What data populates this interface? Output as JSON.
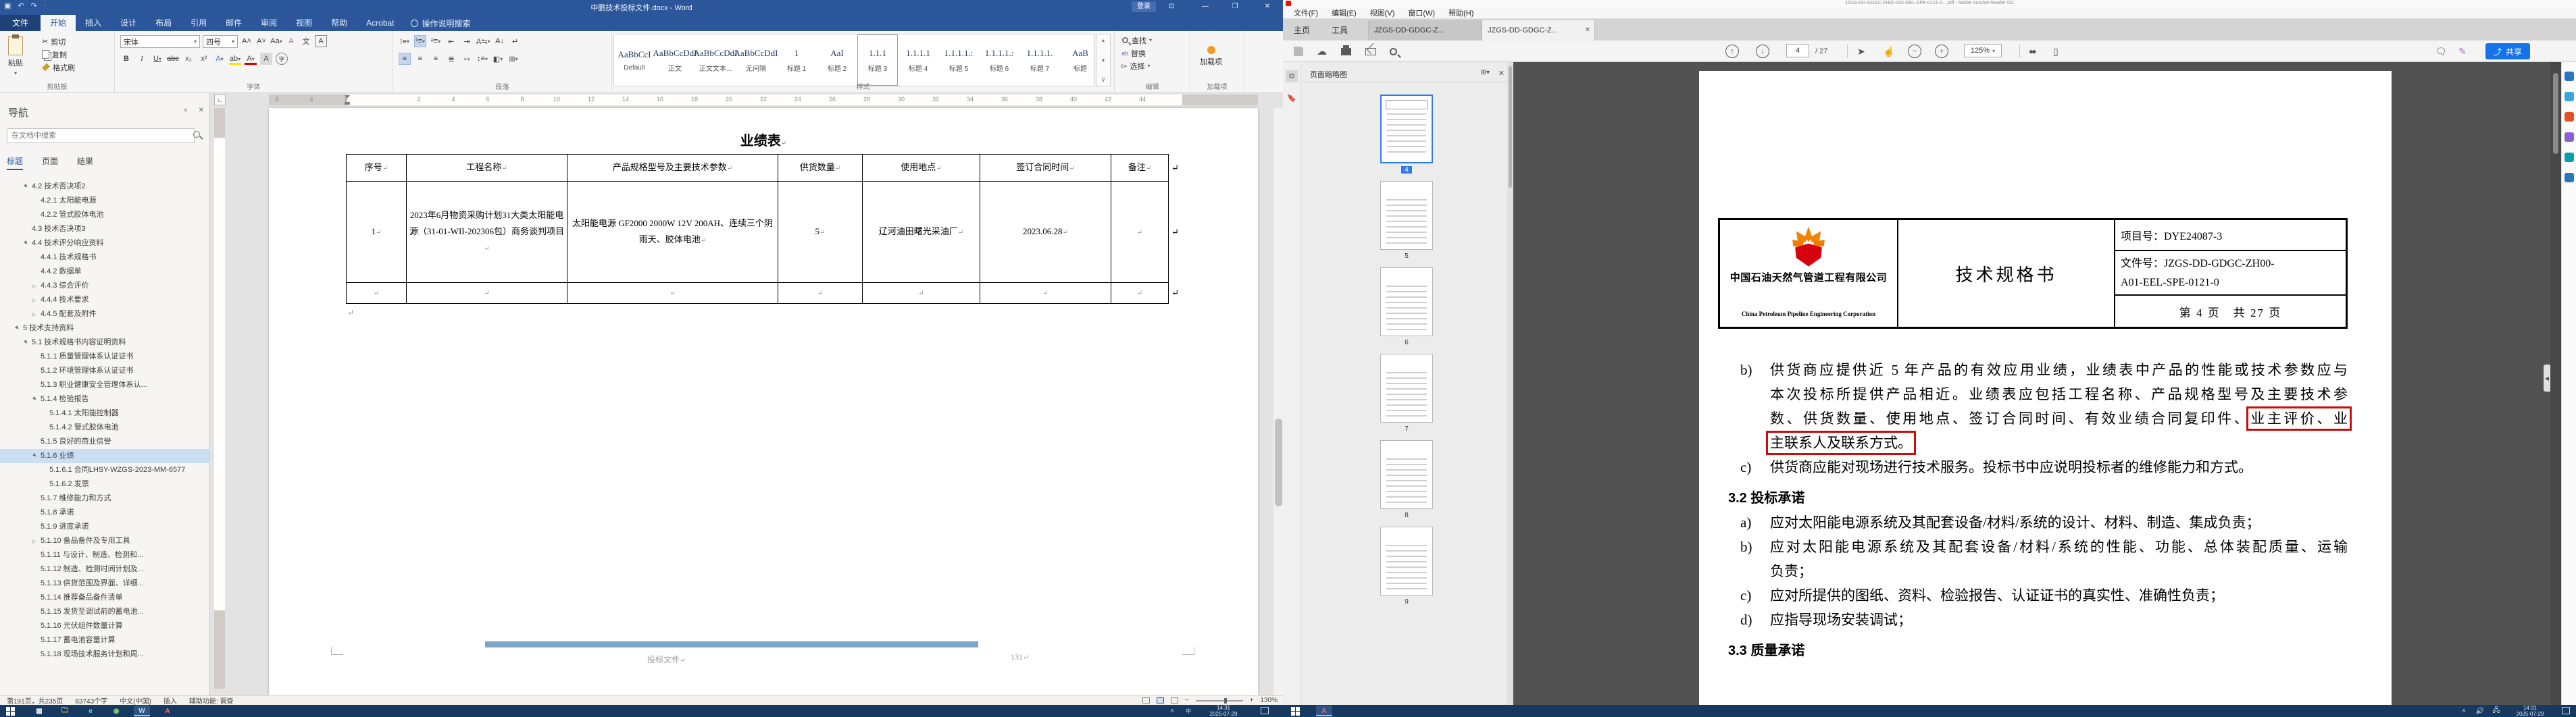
{
  "word": {
    "title": "中鹏技术投标文件.docx - Word",
    "login": "登录",
    "share": "共享",
    "tabs": [
      {
        "label": "文件",
        "file": true
      },
      {
        "label": "开始",
        "active": true
      },
      {
        "label": "插入"
      },
      {
        "label": "设计"
      },
      {
        "label": "布局"
      },
      {
        "label": "引用"
      },
      {
        "label": "邮件"
      },
      {
        "label": "审阅"
      },
      {
        "label": "视图"
      },
      {
        "label": "帮助"
      },
      {
        "label": "Acrobat"
      }
    ],
    "tell_me": "操作说明搜索",
    "ribbon": {
      "paste": "粘贴",
      "cut": "剪切",
      "copy": "复制",
      "format_painter": "格式刷",
      "clipboard_group": "剪贴板",
      "font_name": "宋体",
      "font_size": "四号",
      "font_group": "字体",
      "para_group": "段落",
      "styles_group": "样式",
      "find": "查找",
      "replace": "替换",
      "select": "选择",
      "edit_group": "编辑",
      "addins": "加载项",
      "addins_group": "加载项"
    },
    "styles": [
      {
        "preview": "AaBbCcI",
        "label": "Default"
      },
      {
        "preview": "AaBbCcDdI",
        "label": "正文"
      },
      {
        "preview": "AaBbCcDdI",
        "label": "正文文本..."
      },
      {
        "preview": "AaBbCcDdI",
        "label": "无间隔"
      },
      {
        "preview": "1",
        "label": "标题 1"
      },
      {
        "preview": "AaI",
        "label": "标题 2"
      },
      {
        "preview": "1.1.1",
        "label": "标题 3",
        "selected": true
      },
      {
        "preview": "1.1.1.1",
        "label": "标题 4"
      },
      {
        "preview": "1.1.1.1.:",
        "label": "标题 5"
      },
      {
        "preview": "1.1.1.1.:",
        "label": "标题 6"
      },
      {
        "preview": "1.1.1.1.",
        "label": "标题 7"
      },
      {
        "preview": "AaB",
        "label": "标题"
      }
    ],
    "nav": {
      "title": "导航",
      "search_placeholder": "在文档中搜索",
      "tabs": [
        {
          "label": "标题",
          "active": true
        },
        {
          "label": "页面"
        },
        {
          "label": "结果"
        }
      ],
      "tree": [
        {
          "label": "4.2 技术否决项2",
          "lv": 1,
          "exp": "open"
        },
        {
          "label": "4.2.1 太阳能电源",
          "lv": 2,
          "exp": "leaf"
        },
        {
          "label": "4.2.2 管式胶体电池",
          "lv": 2,
          "exp": "leaf"
        },
        {
          "label": "4.3 技术否决项3",
          "lv": 1,
          "exp": "leaf"
        },
        {
          "label": "4.4 技术评分响应资料",
          "lv": 1,
          "exp": "open"
        },
        {
          "label": "4.4.1 技术规格书",
          "lv": 2,
          "exp": "leaf"
        },
        {
          "label": "4.4.2 数据单",
          "lv": 2,
          "exp": "leaf"
        },
        {
          "label": "4.4.3 综合评价",
          "lv": 2,
          "exp": "closed"
        },
        {
          "label": "4.4.4 技术要求",
          "lv": 2,
          "exp": "closed"
        },
        {
          "label": "4.4.5 配套及附件",
          "lv": 2,
          "exp": "closed"
        },
        {
          "label": "5 技术支持资料",
          "lv": 0,
          "exp": "open"
        },
        {
          "label": "5.1 技术规格书内容证明资料",
          "lv": 1,
          "exp": "open"
        },
        {
          "label": "5.1.1 质量管理体系认证证书",
          "lv": 2,
          "exp": "leaf"
        },
        {
          "label": "5.1.2 环境管理体系认证证书",
          "lv": 2,
          "exp": "leaf"
        },
        {
          "label": "5.1.3 职业健康安全管理体系认...",
          "lv": 2,
          "exp": "leaf"
        },
        {
          "label": "5.1.4 检验报告",
          "lv": 2,
          "exp": "open"
        },
        {
          "label": "5.1.4.1 太阳能控制器",
          "lv": 3,
          "exp": "leaf"
        },
        {
          "label": "5.1.4.2 管式胶体电池",
          "lv": 3,
          "exp": "leaf"
        },
        {
          "label": "5.1.5 良好的商业信誉",
          "lv": 2,
          "exp": "leaf"
        },
        {
          "label": "5.1.6 业绩",
          "lv": 2,
          "exp": "open",
          "selected": true
        },
        {
          "label": "5.1.6.1 合同LHSY-WZGS-2023-MM-6577",
          "lv": 3,
          "exp": "leaf"
        },
        {
          "label": "5.1.6.2 发票",
          "lv": 3,
          "exp": "leaf"
        },
        {
          "label": "5.1.7 维修能力和方式",
          "lv": 2,
          "exp": "leaf"
        },
        {
          "label": "5.1.8 承诺",
          "lv": 2,
          "exp": "leaf"
        },
        {
          "label": "5.1.9 进度承诺",
          "lv": 2,
          "exp": "leaf"
        },
        {
          "label": "5.1.10 备品备件及专用工具",
          "lv": 2,
          "exp": "closed"
        },
        {
          "label": "5.1.11 与设计、制造、检测和...",
          "lv": 2,
          "exp": "leaf"
        },
        {
          "label": "5.1.12 制造、检测时间计划及...",
          "lv": 2,
          "exp": "leaf"
        },
        {
          "label": "5.1.13 供货范围及界面、详细...",
          "lv": 2,
          "exp": "leaf"
        },
        {
          "label": "5.1.14 推荐备品备件清单",
          "lv": 2,
          "exp": "leaf"
        },
        {
          "label": "5.1.15 发货至调试前的蓄电池...",
          "lv": 2,
          "exp": "leaf"
        },
        {
          "label": "5.1.16 光伏组件数量计算",
          "lv": 2,
          "exp": "leaf"
        },
        {
          "label": "5.1.17 蓄电池容量计算",
          "lv": 2,
          "exp": "leaf"
        },
        {
          "label": "5.1.18 现场技术服务计划和周...",
          "lv": 2,
          "exp": "leaf"
        }
      ]
    },
    "doc": {
      "table_title": "业绩表",
      "mark": "↵",
      "headers": [
        "序号",
        "工程名称",
        "产品规格型号及主要技术参数",
        "供货数量",
        "使用地点",
        "签订合同时间",
        "备注"
      ],
      "rows": [
        [
          "1",
          "2023年6月物资采购计划31大类太阳能电源（31-01-WII-202306包）商务谈判项目",
          "太阳能电源 GF2000 2000W 12V 200AH、连续三个阴雨天、胶体电池",
          "5",
          "辽河油田曙光采油厂",
          "2023.06.28",
          ""
        ],
        [
          "",
          "",
          "",
          "",
          "",
          "",
          ""
        ]
      ],
      "footer_text": "投标文件",
      "footer_page": "131",
      "ruler_left": [
        "6",
        "4",
        "2"
      ],
      "ruler_right": [
        "2",
        "4",
        "6",
        "8",
        "10",
        "12",
        "14",
        "16",
        "18",
        "20",
        "22",
        "24",
        "26",
        "28",
        "30",
        "32",
        "34",
        "36",
        "38",
        "40",
        "42",
        "44"
      ]
    },
    "status": {
      "page": "第191页，共235页",
      "words": "83743个字",
      "lang": "中文(中国)",
      "mode": "插入",
      "acc": "辅助功能: 调查",
      "zoom": "130%"
    }
  },
  "pdf": {
    "title": "JZGS-DD-GDGC-ZH00-A01-EEL-SPE-0121-0....pdf - Adobe Acrobat Reader DC",
    "menus": [
      "文件(F)",
      "编辑(E)",
      "视图(V)",
      "窗口(W)",
      "帮助(H)"
    ],
    "home_tab": "主页",
    "tools_tab": "工具",
    "doc_tabs": [
      {
        "label": "JZGS-DD-GDGC-Z..."
      },
      {
        "label": "JZGS-DD-GDGC-Z...",
        "active": true
      }
    ],
    "page_num": "4",
    "page_total": "/ 27",
    "zoom": "125%",
    "share": "共享",
    "panel_title": "页面缩略图",
    "thumbs": [
      "4",
      "5",
      "6",
      "7",
      "8",
      "9"
    ],
    "page": {
      "company_cn": "中国石油天然气管道工程有限公司",
      "company_en": "China Petroleum Pipeline Engineering Corporation",
      "doc_title": "技术规格书",
      "project_no": "项目号：DYE24087-3",
      "file_no_1": "文件号：JZGS-DD-GDGC-ZH00-",
      "file_no_2": "A01-EEL-SPE-0121-0",
      "page_info": "第 4 页　共 27 页",
      "body": [
        {
          "type": "item",
          "marker": "b)",
          "just": true,
          "segs": [
            {
              "t": "供货商应提供近 5 年产品的有效应用业绩，业绩表中产品的性能或技术参数应与"
            }
          ]
        },
        {
          "type": "cont",
          "just": true,
          "segs": [
            {
              "t": "本次投标所提供产品相近。业绩表应包括工程名称、产品规格型号及主要技术参"
            }
          ]
        },
        {
          "type": "cont",
          "just": true,
          "segs": [
            {
              "t": "数、供货数量、使用地点、签订合同时间、有效业绩合同复印件、"
            },
            {
              "t": "业主评价、业",
              "red": true
            }
          ]
        },
        {
          "type": "cont",
          "segs": [
            {
              "t": "主联系人及联系方式。",
              "red": true
            }
          ]
        },
        {
          "type": "item",
          "marker": "c)",
          "segs": [
            {
              "t": "供货商应能对现场进行技术服务。投标书中应说明投标者的维修能力和方式。"
            }
          ]
        },
        {
          "type": "head",
          "segs": [
            {
              "t": "3.2 投标承诺"
            }
          ]
        },
        {
          "type": "item",
          "marker": "a)",
          "segs": [
            {
              "t": "应对太阳能电源系统及其配套设备/材料/系统的设计、材料、制造、集成负责；"
            }
          ]
        },
        {
          "type": "item",
          "marker": "b)",
          "just": true,
          "segs": [
            {
              "t": "应对太阳能电源系统及其配套设备/材料/系统的性能、功能、总体装配质量、运输"
            }
          ]
        },
        {
          "type": "cont",
          "segs": [
            {
              "t": "负责；"
            }
          ]
        },
        {
          "type": "item",
          "marker": "c)",
          "segs": [
            {
              "t": "应对所提供的图纸、资料、检验报告、认证证书的真实性、准确性负责；"
            }
          ]
        },
        {
          "type": "item",
          "marker": "d)",
          "segs": [
            {
              "t": "应指导现场安装调试；"
            }
          ]
        },
        {
          "type": "head",
          "segs": [
            {
              "t": "3.3 质量承诺"
            }
          ]
        }
      ]
    }
  },
  "taskbar": {
    "time": "14:31",
    "date": "2025-07-29"
  }
}
